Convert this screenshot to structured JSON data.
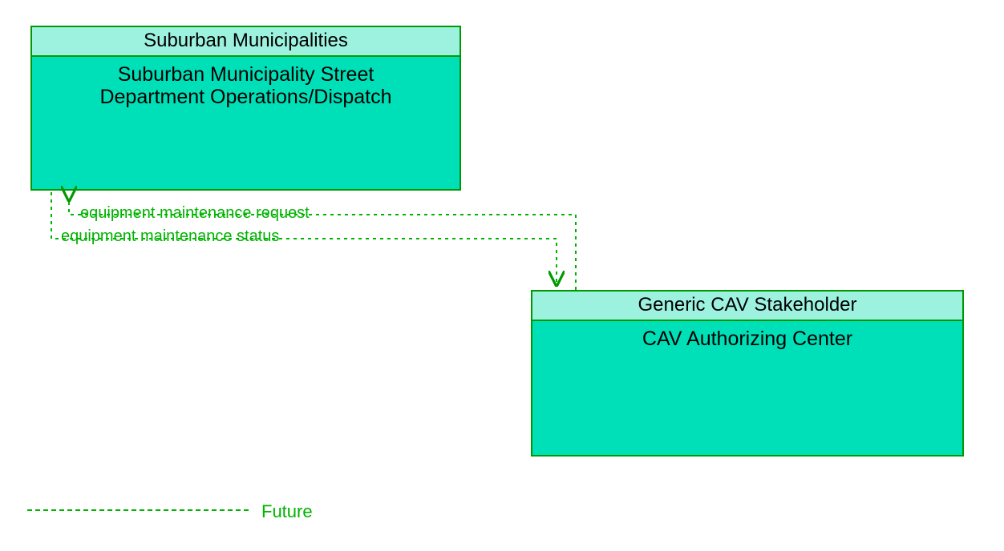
{
  "nodes": {
    "a": {
      "header": "Suburban Municipalities",
      "body_l1": "Suburban Municipality Street",
      "body_l2": "Department Operations/Dispatch"
    },
    "b": {
      "header": "Generic CAV Stakeholder",
      "body_l1": "CAV Authorizing Center"
    }
  },
  "flows": {
    "to_a": "equipment maintenance request",
    "to_b": "equipment maintenance status"
  },
  "legend": {
    "future": "Future"
  },
  "colors": {
    "border": "#009900",
    "header_fill": "#9df2df",
    "body_fill": "#00e0b8",
    "flow": "#00b300"
  }
}
